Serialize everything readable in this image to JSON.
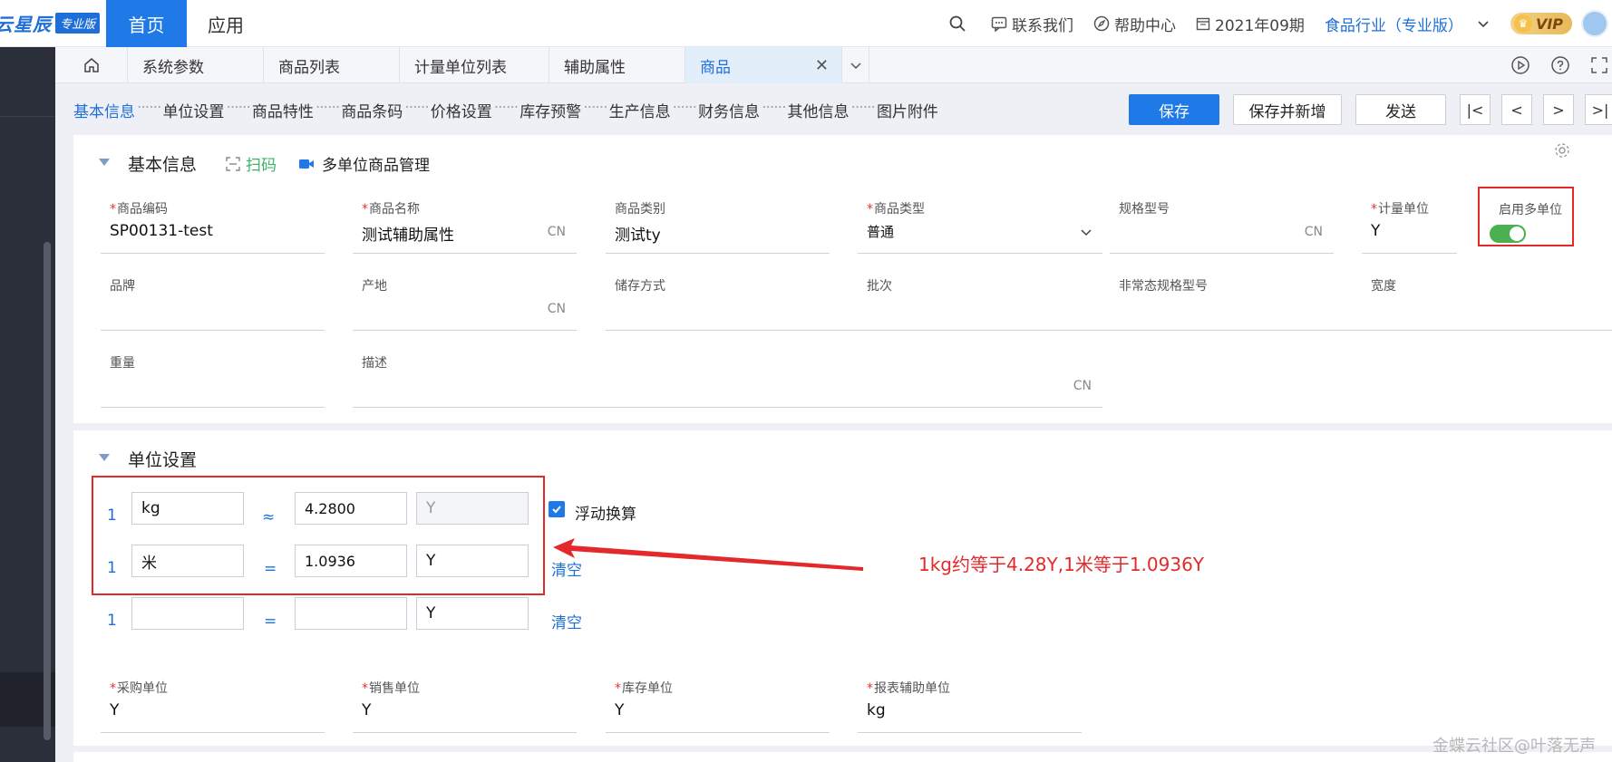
{
  "header": {
    "brand": "云星辰",
    "edition": "专业版",
    "nav": {
      "home": "首页",
      "app": "应用"
    },
    "contact": "联系我们",
    "help": "帮助中心",
    "period": "2021年09期",
    "industry": "食品行业（专业版）",
    "vip": "VIP"
  },
  "tabs": [
    {
      "label": "系统参数"
    },
    {
      "label": "商品列表"
    },
    {
      "label": "计量单位列表"
    },
    {
      "label": "辅助属性"
    },
    {
      "label": "商品",
      "active": true
    }
  ],
  "section_nav": [
    "基本信息",
    "单位设置",
    "商品特性",
    "商品条码",
    "价格设置",
    "库存预警",
    "生产信息",
    "财务信息",
    "其他信息",
    "图片附件"
  ],
  "section_nav_dash": "······",
  "actions": {
    "save": "保存",
    "save_new": "保存并新增",
    "send": "发送"
  },
  "basic": {
    "title": "基本信息",
    "scan": "扫码",
    "multi_unit_mgmt": "多单位商品管理",
    "cn": "CN",
    "fields": {
      "code": {
        "label": "商品编码",
        "value": "SP00131-test",
        "required": true
      },
      "name": {
        "label": "商品名称",
        "value": "测试辅助属性",
        "required": true
      },
      "category": {
        "label": "商品类别",
        "value": "测试ty"
      },
      "type": {
        "label": "商品类型",
        "value": "普通",
        "required": true
      },
      "spec": {
        "label": "规格型号",
        "value": ""
      },
      "unit": {
        "label": "计量单位",
        "value": "Y",
        "required": true
      },
      "multi_unit": {
        "label": "启用多单位",
        "enabled": true
      },
      "brand": {
        "label": "品牌"
      },
      "origin": {
        "label": "产地"
      },
      "storage": {
        "label": "储存方式"
      },
      "batch": {
        "label": "批次"
      },
      "nonstd_spec": {
        "label": "非常态规格型号"
      },
      "width": {
        "label": "宽度"
      },
      "weight": {
        "label": "重量"
      },
      "desc": {
        "label": "描述"
      }
    }
  },
  "units": {
    "title": "单位设置",
    "rows": [
      {
        "qty": "1",
        "unit": "kg",
        "op": "≈",
        "ratio": "4.2800",
        "base": "Y"
      },
      {
        "qty": "1",
        "unit": "米",
        "op": "=",
        "ratio": "1.0936",
        "base": "Y",
        "clear": "清空"
      },
      {
        "qty": "1",
        "unit": "",
        "op": "=",
        "ratio": "",
        "base": "Y",
        "clear": "清空"
      }
    ],
    "float_conv": "浮动换算",
    "purchase": {
      "label": "采购单位",
      "value": "Y"
    },
    "sales": {
      "label": "销售单位",
      "value": "Y"
    },
    "stock": {
      "label": "库存单位",
      "value": "Y"
    },
    "report": {
      "label": "报表辅助单位",
      "value": "kg"
    }
  },
  "annotation": "1kg约等于4.28Y,1米等于1.0936Y",
  "watermark": "金蝶云社区@叶落无声",
  "colors": {
    "accent": "#1f7ae8",
    "annotation": "#e4292b",
    "toggle": "#4caf50"
  }
}
